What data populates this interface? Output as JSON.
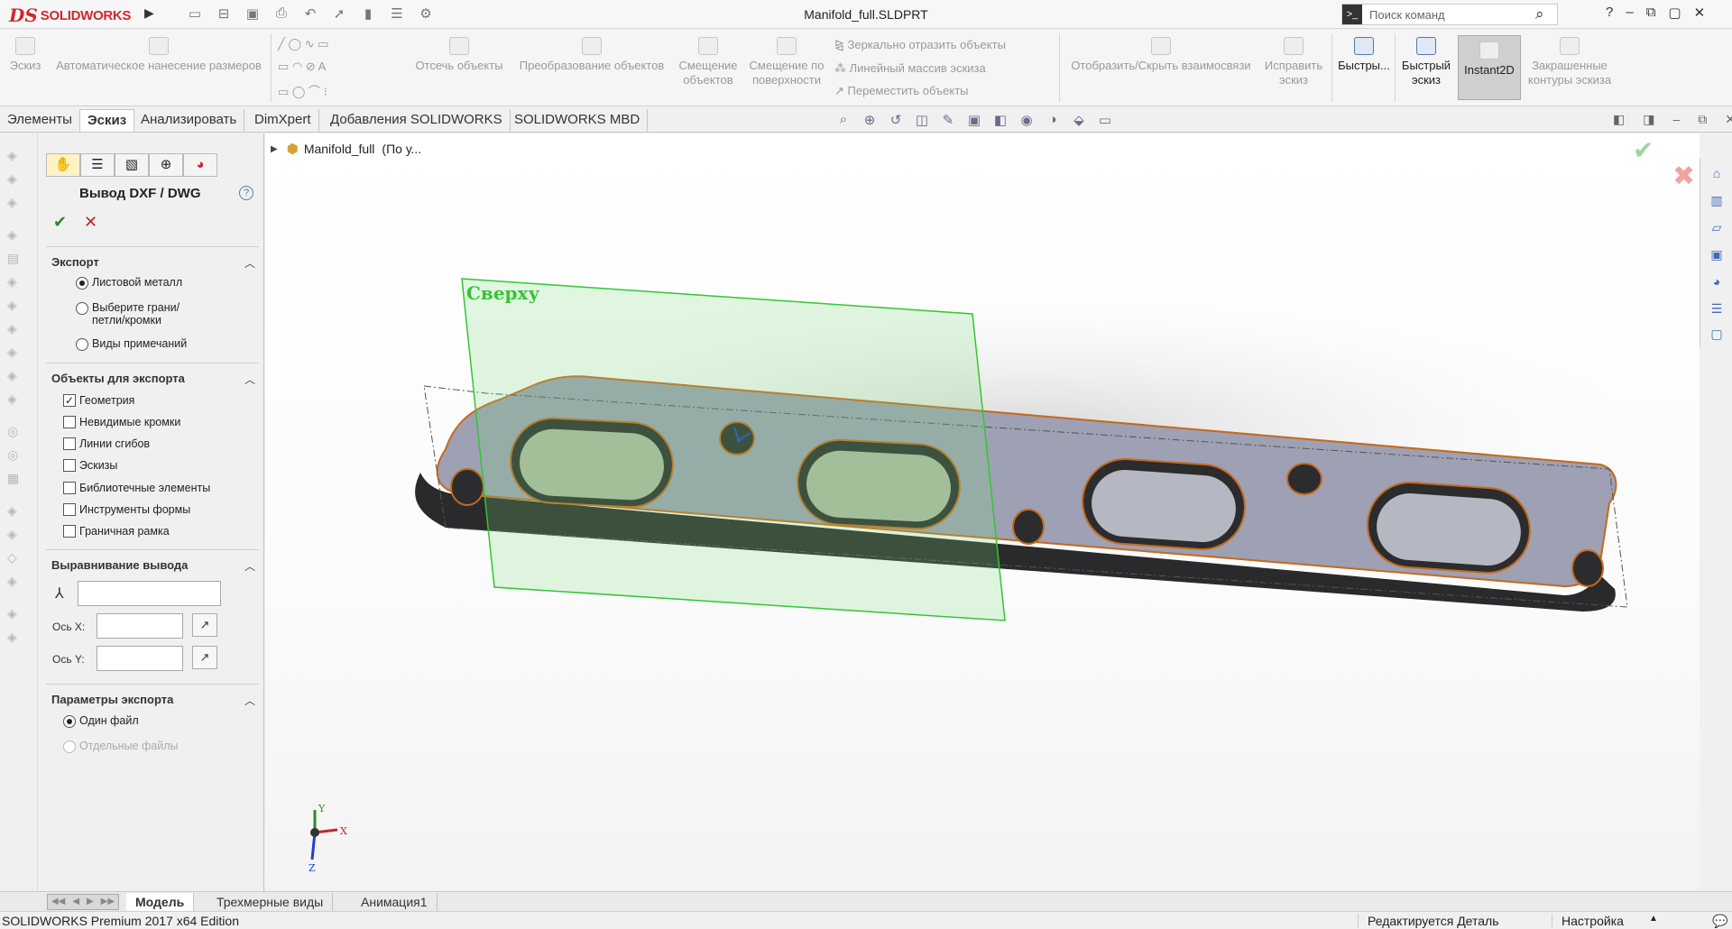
{
  "app": {
    "logo_prefix": "DS",
    "logo_text": "SOLIDWORKS",
    "window_title": "Manifold_full.SLDPRT",
    "search_placeholder": "Поиск команд",
    "help": "?",
    "accent_color": "#d0282e"
  },
  "quick_access": [
    "new-icon",
    "open-icon",
    "save-icon",
    "print-icon",
    "undo-icon",
    "select-icon",
    "rebuild-icon",
    "file-props-icon",
    "options-icon"
  ],
  "ribbon": {
    "sketch": "Эскиз",
    "smart_dim": "Автоматическое нанесение размеров",
    "trim": "Отсечь объекты",
    "convert": "Преобразование объектов",
    "offset": "Смещение объектов",
    "offset_surface": "Смещение по поверхности",
    "mirror": "Зеркально отразить объекты",
    "linear_pattern": "Линейный массив эскиза",
    "move": "Переместить объекты",
    "display_relations": "Отобразить/Скрыть взаимосвязи",
    "repair": "Исправить эскиз",
    "quick_snaps": "Быстры...",
    "rapid_sketch": "Быстрый эскиз",
    "instant2d": "Instant2D",
    "shaded_contours": "Закрашенные контуры эскиза"
  },
  "tabs": [
    "Элементы",
    "Эскиз",
    "Анализировать",
    "DimXpert",
    "Добавления SOLIDWORKS",
    "SOLIDWORKS MBD"
  ],
  "active_tab": "Эскиз",
  "panel": {
    "title": "Вывод DXF / DWG",
    "export": {
      "header": "Экспорт",
      "options": [
        "Листовой металл",
        "Выберите грани/петли/кромки",
        "Виды примечаний"
      ],
      "selected": "Листовой металл"
    },
    "objects": {
      "header": "Объекты для экспорта",
      "items": [
        {
          "label": "Геометрия",
          "checked": true
        },
        {
          "label": "Невидимые кромки",
          "checked": false
        },
        {
          "label": "Линии сгибов",
          "checked": false
        },
        {
          "label": "Эскизы",
          "checked": false
        },
        {
          "label": "Библиотечные элементы",
          "checked": false
        },
        {
          "label": "Инструменты формы",
          "checked": false
        },
        {
          "label": "Граничная рамка",
          "checked": false
        }
      ]
    },
    "alignment": {
      "header": "Выравнивание вывода",
      "axis_x": "Ось X:",
      "axis_y": "Ось Y:"
    },
    "params": {
      "header": "Параметры экспорта",
      "single": "Один файл",
      "separate": "Отдельные файлы"
    }
  },
  "viewport": {
    "tree_item": "Manifold_full",
    "tree_suffix": "(По у...",
    "plane_label": "Сверху",
    "axis_x": "X",
    "axis_y": "Y",
    "axis_z": "Z"
  },
  "bottom_tabs": [
    "Модель",
    "Трехмерные виды",
    "Анимация1"
  ],
  "status": {
    "edition": "SOLIDWORKS Premium 2017 x64 Edition",
    "editing": "Редактируется Деталь",
    "settings": "Настройка"
  }
}
